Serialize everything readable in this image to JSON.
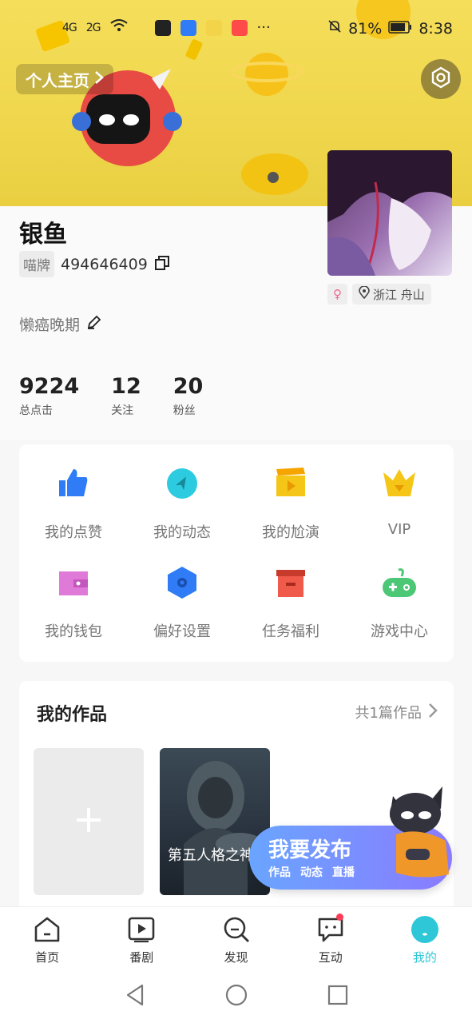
{
  "status_bar": {
    "signal1": "4G",
    "signal2": "2G",
    "battery": "81%",
    "time": "8:38",
    "more": "···"
  },
  "header": {
    "home_label": "个人主页",
    "settings_icon": "gear-icon"
  },
  "profile": {
    "name": "银鱼",
    "id_tag": "喵牌",
    "id_number": "494646409",
    "bio": "懒癌晚期",
    "gender_symbol": "♀",
    "location": "浙江 舟山"
  },
  "stats": [
    {
      "value": "9224",
      "label": "总点击"
    },
    {
      "value": "12",
      "label": "关注"
    },
    {
      "value": "20",
      "label": "粉丝"
    }
  ],
  "menu": [
    {
      "label": "我的点赞",
      "icon": "thumbs-up-icon",
      "color": "#2f7cf6"
    },
    {
      "label": "我的动态",
      "icon": "compass-icon",
      "color": "#2ccbe0"
    },
    {
      "label": "我的尬演",
      "icon": "clapperboard-icon",
      "color": "#f5c518"
    },
    {
      "label": "VIP",
      "icon": "crown-icon",
      "color": "#f5c518"
    },
    {
      "label": "我的钱包",
      "icon": "wallet-icon",
      "color": "#e07ad8"
    },
    {
      "label": "偏好设置",
      "icon": "hexagon-settings-icon",
      "color": "#2f7cf6"
    },
    {
      "label": "任务福利",
      "icon": "gift-box-icon",
      "color": "#f05a4a"
    },
    {
      "label": "游戏中心",
      "icon": "gamepad-icon",
      "color": "#4cc776"
    }
  ],
  "works": {
    "title": "我的作品",
    "count": "共1篇作品",
    "items": [
      {
        "title": "第五人格之神秘游戏"
      }
    ]
  },
  "publish": {
    "title": "我要发布",
    "options": [
      "作品",
      "动态",
      "直播"
    ]
  },
  "tabbar": [
    {
      "label": "首页",
      "icon": "home-icon"
    },
    {
      "label": "番剧",
      "icon": "play-icon"
    },
    {
      "label": "发现",
      "icon": "discover-icon"
    },
    {
      "label": "互动",
      "icon": "message-icon"
    },
    {
      "label": "我的",
      "icon": "profile-icon"
    }
  ],
  "accent_color": "#2ec7d8"
}
